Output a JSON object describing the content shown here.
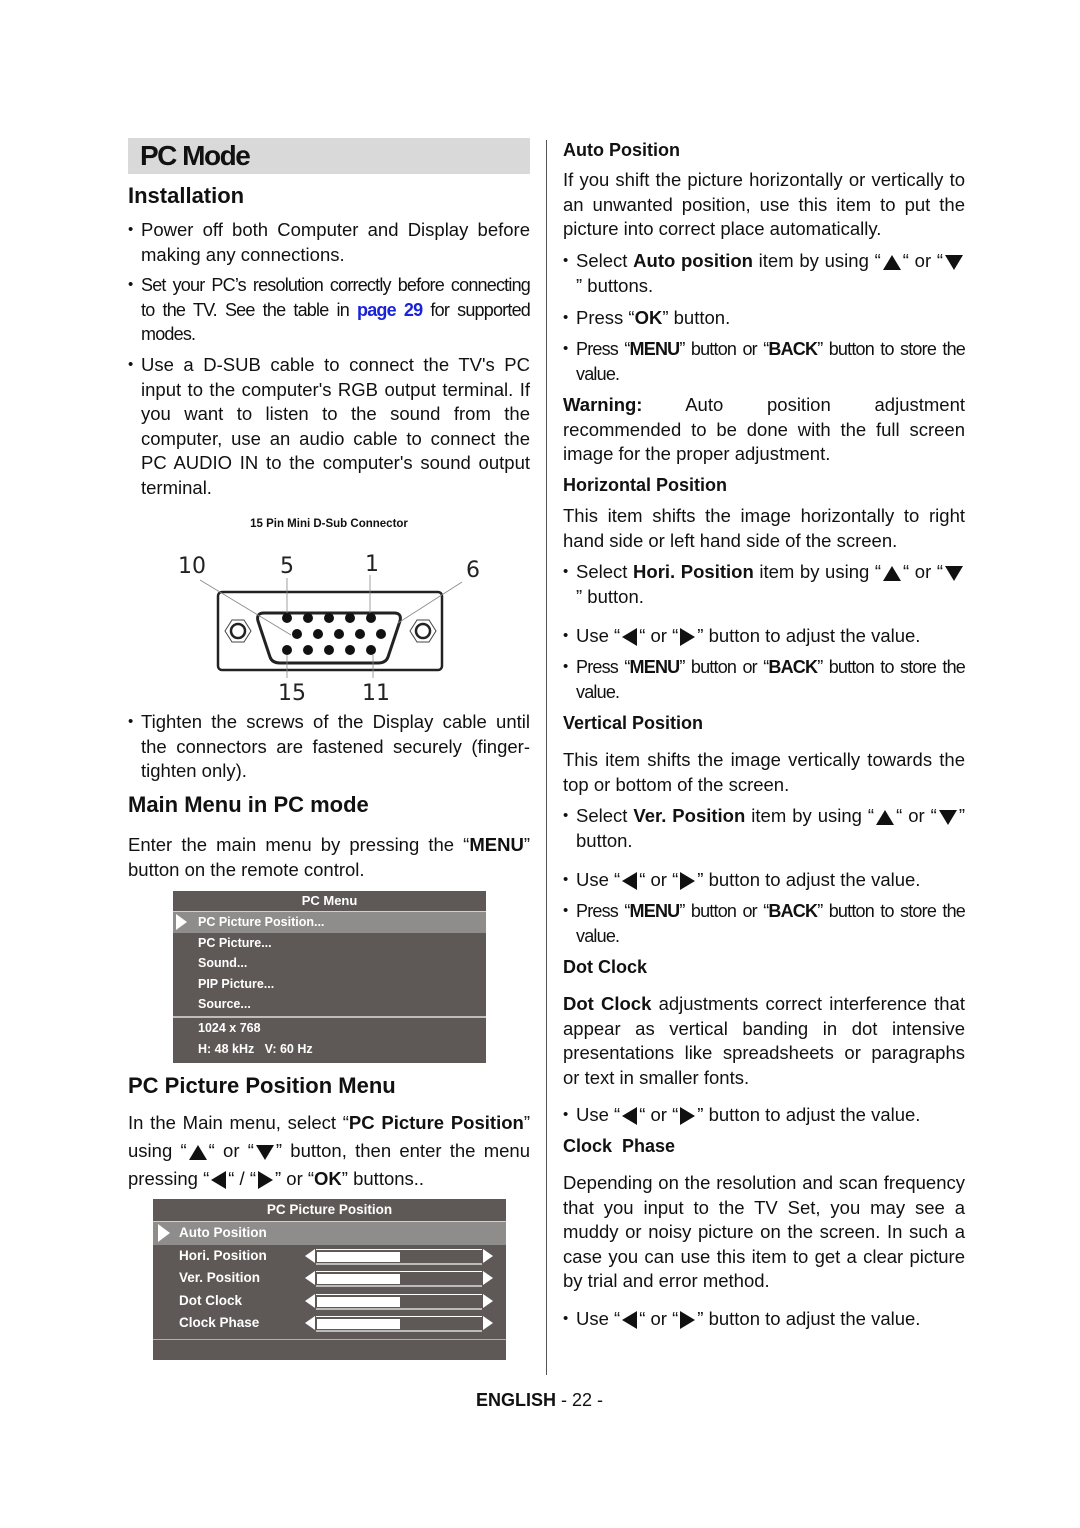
{
  "page_title": "PC Mode",
  "left": {
    "installation": {
      "heading": "Installation",
      "bullets": [
        "Power off both Computer and Display before making any connections.",
        {
          "pre": "Set your PC’s resolution correctly before connecting to the TV. See the table in ",
          "link": "page 29",
          "post": " for supported modes."
        },
        "Use a D-SUB cable to connect the TV's PC input to the computer's RGB output terminal. If you want to listen to the sound from the computer, use an audio cable to connect the PC AUDIO IN to the computer's sound output terminal.",
        "Tighten the screws of the Display cable until the connectors are fastened securely (finger-tighten only)."
      ]
    },
    "connector_figure": {
      "caption": "15 Pin Mini D-Sub Connector",
      "pin_labels": {
        "top_left": "10",
        "top_mid_left": "5",
        "top_mid_right": "1",
        "top_right": "6",
        "bottom_left": "15",
        "bottom_right": "11"
      }
    },
    "main_menu": {
      "heading": "Main Menu in PC mode",
      "text_pre": "Enter the main menu by pressing the “",
      "text_bold": "MENU",
      "text_post": "” button on the remote control.",
      "osd": {
        "title": "PC Menu",
        "items": [
          "PC Picture Position...",
          "PC Picture...",
          "Sound...",
          "PIP Picture...",
          "Source..."
        ],
        "selected_index": 0,
        "resolution": "1024 x 768",
        "frequency": "H: 48 kHz   V: 60 Hz"
      }
    },
    "pc_picture_position_menu": {
      "heading": "PC Picture Position Menu",
      "text": {
        "a": "In the Main menu, select “",
        "b": "PC Picture Position",
        "c": "” using “",
        "d": "“ or “",
        "e": "” button, then enter the menu pressing  “",
        "f": "“ /  “",
        "g": "”  or “",
        "h": "OK",
        "i": "” buttons.."
      },
      "osd": {
        "title": "PC Picture Position",
        "items": [
          {
            "label": "Auto Position",
            "slider": null
          },
          {
            "label": "Hori. Position",
            "slider": 0.5
          },
          {
            "label": "Ver. Position",
            "slider": 0.5
          },
          {
            "label": "Dot Clock",
            "slider": 0.5
          },
          {
            "label": "Clock Phase",
            "slider": 0.5
          }
        ],
        "selected_index": 0
      }
    }
  },
  "right": {
    "auto_position": {
      "heading": "Auto Position",
      "text": "If you shift the picture horizontally or vertically to an unwanted position, use this item to put the picture into correct place automatically.",
      "select_pre": "Select ",
      "select_bold": "Auto position",
      "select_post": " item by using “",
      "select_or": "“ or “",
      "select_end": "” buttons.",
      "press_ok_pre": "Press “",
      "press_ok_bold": "OK",
      "press_ok_post": "” button.",
      "store": {
        "a": "Press “",
        "b": "MENU",
        "c": "” button or “",
        "d": "BACK",
        "e": "” button to store the value."
      },
      "warning_label": "Warning:",
      "warning_text": " Auto position adjustment recommended to be done with the full screen image for the proper adjustment."
    },
    "horizontal_position": {
      "heading": "Horizontal Position",
      "text": "This item shifts the image horizontally to right hand side or left hand side of the screen.",
      "select_pre": "Select ",
      "select_bold": "Hori. Position",
      "select_post": " item by using “",
      "select_or": "“ or “",
      "select_end": "”  button.",
      "use": {
        "a": "Use “",
        "b": "“ or “",
        "c": "” button to adjust the value."
      },
      "store": {
        "a": "Press “",
        "b": "MENU",
        "c": "” button or “",
        "d": "BACK",
        "e": "” button to store the value."
      }
    },
    "vertical_position": {
      "heading": "Vertical  Position",
      "text": "This item shifts the image vertically towards the top or bottom of the screen.",
      "select_pre": "Select ",
      "select_bold": "Ver. Position",
      "select_post": " item by using “",
      "select_or": "“ or “",
      "select_end": "” button.",
      "use": {
        "a": "Use “",
        "b": "“ or “",
        "c": "” button to adjust the value."
      },
      "store": {
        "a": "Press “",
        "b": "MENU",
        "c": "” button or “",
        "d": "BACK",
        "e": "” button to store the value."
      }
    },
    "dot_clock": {
      "heading": "Dot Clock",
      "text_bold": "Dot Clock",
      "text": " adjustments correct interference that appear as vertical banding in dot intensive presentations like spreadsheets or paragraphs or text in smaller fonts.",
      "use": {
        "a": "Use “",
        "b": "“ or “",
        "c": "” button to adjust the value."
      }
    },
    "clock_phase": {
      "heading": "Clock  Phase",
      "text": "Depending on the resolution and scan frequency that you input to the TV Set, you may see a muddy or noisy picture on the screen. In such a case you can use this item to get a clear picture by trial and error method.",
      "use": {
        "a": "Use “",
        "b": "“ or “",
        "c": "” button to adjust the value."
      }
    }
  },
  "footer": {
    "language": "ENGLISH",
    "page": " - 22 -"
  }
}
